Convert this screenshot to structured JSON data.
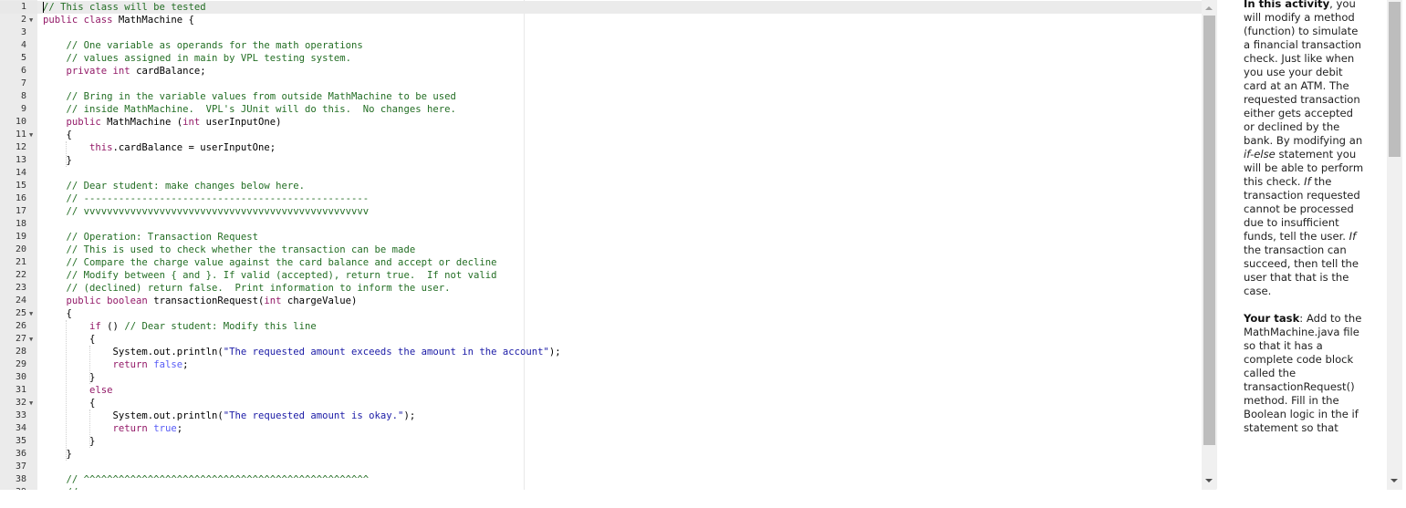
{
  "editor": {
    "file_name": "MathMachine.java",
    "active_line": 1,
    "lines": [
      {
        "n": "1",
        "fold": false,
        "tokens": [
          {
            "t": "comment",
            "v": "// This class will be tested"
          }
        ]
      },
      {
        "n": "2",
        "fold": true,
        "tokens": [
          {
            "t": "keyword",
            "v": "public class"
          },
          {
            "t": "plain",
            "v": " MathMachine {"
          }
        ]
      },
      {
        "n": "3",
        "fold": false,
        "tokens": []
      },
      {
        "n": "4",
        "fold": false,
        "tokens": [
          {
            "t": "plain",
            "v": "    "
          },
          {
            "t": "comment",
            "v": "// One variable as operands for the math operations"
          }
        ]
      },
      {
        "n": "5",
        "fold": false,
        "tokens": [
          {
            "t": "plain",
            "v": "    "
          },
          {
            "t": "comment",
            "v": "// values assigned in main by VPL testing system."
          }
        ]
      },
      {
        "n": "6",
        "fold": false,
        "tokens": [
          {
            "t": "plain",
            "v": "    "
          },
          {
            "t": "keyword",
            "v": "private int"
          },
          {
            "t": "plain",
            "v": " cardBalance;"
          }
        ]
      },
      {
        "n": "7",
        "fold": false,
        "tokens": []
      },
      {
        "n": "8",
        "fold": false,
        "tokens": [
          {
            "t": "plain",
            "v": "    "
          },
          {
            "t": "comment",
            "v": "// Bring in the variable values from outside MathMachine to be used"
          }
        ]
      },
      {
        "n": "9",
        "fold": false,
        "tokens": [
          {
            "t": "plain",
            "v": "    "
          },
          {
            "t": "comment",
            "v": "// inside MathMachine.  VPL's JUnit will do this.  No changes here."
          }
        ]
      },
      {
        "n": "10",
        "fold": false,
        "tokens": [
          {
            "t": "plain",
            "v": "    "
          },
          {
            "t": "keyword",
            "v": "public"
          },
          {
            "t": "plain",
            "v": " MathMachine ("
          },
          {
            "t": "keyword",
            "v": "int"
          },
          {
            "t": "plain",
            "v": " userInputOne)"
          }
        ]
      },
      {
        "n": "11",
        "fold": true,
        "tokens": [
          {
            "t": "plain",
            "v": "    {"
          }
        ]
      },
      {
        "n": "12",
        "fold": false,
        "tokens": [
          {
            "t": "plain",
            "v": "        "
          },
          {
            "t": "keyword",
            "v": "this"
          },
          {
            "t": "plain",
            "v": ".cardBalance = userInputOne;"
          }
        ]
      },
      {
        "n": "13",
        "fold": false,
        "tokens": [
          {
            "t": "plain",
            "v": "    }"
          }
        ]
      },
      {
        "n": "14",
        "fold": false,
        "tokens": []
      },
      {
        "n": "15",
        "fold": false,
        "tokens": [
          {
            "t": "plain",
            "v": "    "
          },
          {
            "t": "comment",
            "v": "// Dear student: make changes below here."
          }
        ]
      },
      {
        "n": "16",
        "fold": false,
        "tokens": [
          {
            "t": "plain",
            "v": "    "
          },
          {
            "t": "comment",
            "v": "// -------------------------------------------------"
          }
        ]
      },
      {
        "n": "17",
        "fold": false,
        "tokens": [
          {
            "t": "plain",
            "v": "    "
          },
          {
            "t": "comment",
            "v": "// vvvvvvvvvvvvvvvvvvvvvvvvvvvvvvvvvvvvvvvvvvvvvvvvv"
          }
        ]
      },
      {
        "n": "18",
        "fold": false,
        "tokens": []
      },
      {
        "n": "19",
        "fold": false,
        "tokens": [
          {
            "t": "plain",
            "v": "    "
          },
          {
            "t": "comment",
            "v": "// Operation: Transaction Request"
          }
        ]
      },
      {
        "n": "20",
        "fold": false,
        "tokens": [
          {
            "t": "plain",
            "v": "    "
          },
          {
            "t": "comment",
            "v": "// This is used to check whether the transaction can be made"
          }
        ]
      },
      {
        "n": "21",
        "fold": false,
        "tokens": [
          {
            "t": "plain",
            "v": "    "
          },
          {
            "t": "comment",
            "v": "// Compare the charge value against the card balance and accept or decline"
          }
        ]
      },
      {
        "n": "22",
        "fold": false,
        "tokens": [
          {
            "t": "plain",
            "v": "    "
          },
          {
            "t": "comment",
            "v": "// Modify between { and }. If valid (accepted), return true.  If not valid"
          }
        ]
      },
      {
        "n": "23",
        "fold": false,
        "tokens": [
          {
            "t": "plain",
            "v": "    "
          },
          {
            "t": "comment",
            "v": "// (declined) return false.  Print information to inform the user."
          }
        ]
      },
      {
        "n": "24",
        "fold": false,
        "tokens": [
          {
            "t": "plain",
            "v": "    "
          },
          {
            "t": "keyword",
            "v": "public boolean"
          },
          {
            "t": "plain",
            "v": " transactionRequest("
          },
          {
            "t": "keyword",
            "v": "int"
          },
          {
            "t": "plain",
            "v": " chargeValue)"
          }
        ]
      },
      {
        "n": "25",
        "fold": true,
        "tokens": [
          {
            "t": "plain",
            "v": "    {"
          }
        ]
      },
      {
        "n": "26",
        "fold": false,
        "tokens": [
          {
            "t": "plain",
            "v": "        "
          },
          {
            "t": "keyword",
            "v": "if"
          },
          {
            "t": "plain",
            "v": " () "
          },
          {
            "t": "comment",
            "v": "// Dear student: Modify this line"
          }
        ]
      },
      {
        "n": "27",
        "fold": true,
        "tokens": [
          {
            "t": "plain",
            "v": "        {"
          }
        ]
      },
      {
        "n": "28",
        "fold": false,
        "tokens": [
          {
            "t": "plain",
            "v": "            System.out.println("
          },
          {
            "t": "string",
            "v": "\"The requested amount exceeds the amount in the account\""
          },
          {
            "t": "plain",
            "v": ");"
          }
        ]
      },
      {
        "n": "29",
        "fold": false,
        "tokens": [
          {
            "t": "plain",
            "v": "            "
          },
          {
            "t": "keyword",
            "v": "return"
          },
          {
            "t": "plain",
            "v": " "
          },
          {
            "t": "const",
            "v": "false"
          },
          {
            "t": "plain",
            "v": ";"
          }
        ]
      },
      {
        "n": "30",
        "fold": false,
        "tokens": [
          {
            "t": "plain",
            "v": "        }"
          }
        ]
      },
      {
        "n": "31",
        "fold": false,
        "tokens": [
          {
            "t": "plain",
            "v": "        "
          },
          {
            "t": "keyword",
            "v": "else"
          }
        ]
      },
      {
        "n": "32",
        "fold": true,
        "tokens": [
          {
            "t": "plain",
            "v": "        {"
          }
        ]
      },
      {
        "n": "33",
        "fold": false,
        "tokens": [
          {
            "t": "plain",
            "v": "            System.out.println("
          },
          {
            "t": "string",
            "v": "\"The requested amount is okay.\""
          },
          {
            "t": "plain",
            "v": ");"
          }
        ]
      },
      {
        "n": "34",
        "fold": false,
        "tokens": [
          {
            "t": "plain",
            "v": "            "
          },
          {
            "t": "keyword",
            "v": "return"
          },
          {
            "t": "plain",
            "v": " "
          },
          {
            "t": "const",
            "v": "true"
          },
          {
            "t": "plain",
            "v": ";"
          }
        ]
      },
      {
        "n": "35",
        "fold": false,
        "tokens": [
          {
            "t": "plain",
            "v": "        }"
          }
        ]
      },
      {
        "n": "36",
        "fold": false,
        "tokens": [
          {
            "t": "plain",
            "v": "    }"
          }
        ]
      },
      {
        "n": "37",
        "fold": false,
        "tokens": []
      },
      {
        "n": "38",
        "fold": false,
        "tokens": [
          {
            "t": "plain",
            "v": "    "
          },
          {
            "t": "comment",
            "v": "// ^^^^^^^^^^^^^^^^^^^^^^^^^^^^^^^^^^^^^^^^^^^^^^^^^"
          }
        ]
      },
      {
        "n": "39",
        "fold": false,
        "tokens": [
          {
            "t": "plain",
            "v": "    "
          },
          {
            "t": "comment",
            "v": "//"
          }
        ]
      }
    ],
    "scroll": {
      "thumb_fraction": 0.93,
      "position_fraction": 0.0
    }
  },
  "description": {
    "paragraphs": [
      [
        {
          "t": "b",
          "v": "In this activity"
        },
        {
          "t": "plain",
          "v": ", you will modify a method (function) to simulate a financial transaction check. Just like when you use your debit card at an ATM. The requested transaction either gets accepted or declined by the bank. By modifying an "
        },
        {
          "t": "i",
          "v": "if-else"
        },
        {
          "t": "plain",
          "v": " statement you will be able to perform this check. "
        },
        {
          "t": "i",
          "v": "If"
        },
        {
          "t": "plain",
          "v": " the transaction requested cannot be processed due to insufficient funds, tell the user.  "
        },
        {
          "t": "i",
          "v": "If"
        },
        {
          "t": "plain",
          "v": " the transaction can succeed, then tell the user that that is the case."
        }
      ],
      [
        {
          "t": "b",
          "v": "Your task"
        },
        {
          "t": "plain",
          "v": ": Add to the MathMachine.java file so that it has a complete code block called the transactionRequest() method. Fill in the Boolean logic in the if statement so that"
        }
      ]
    ],
    "scroll": {
      "thumb_fraction": 0.32,
      "position_fraction": 0.0
    }
  }
}
